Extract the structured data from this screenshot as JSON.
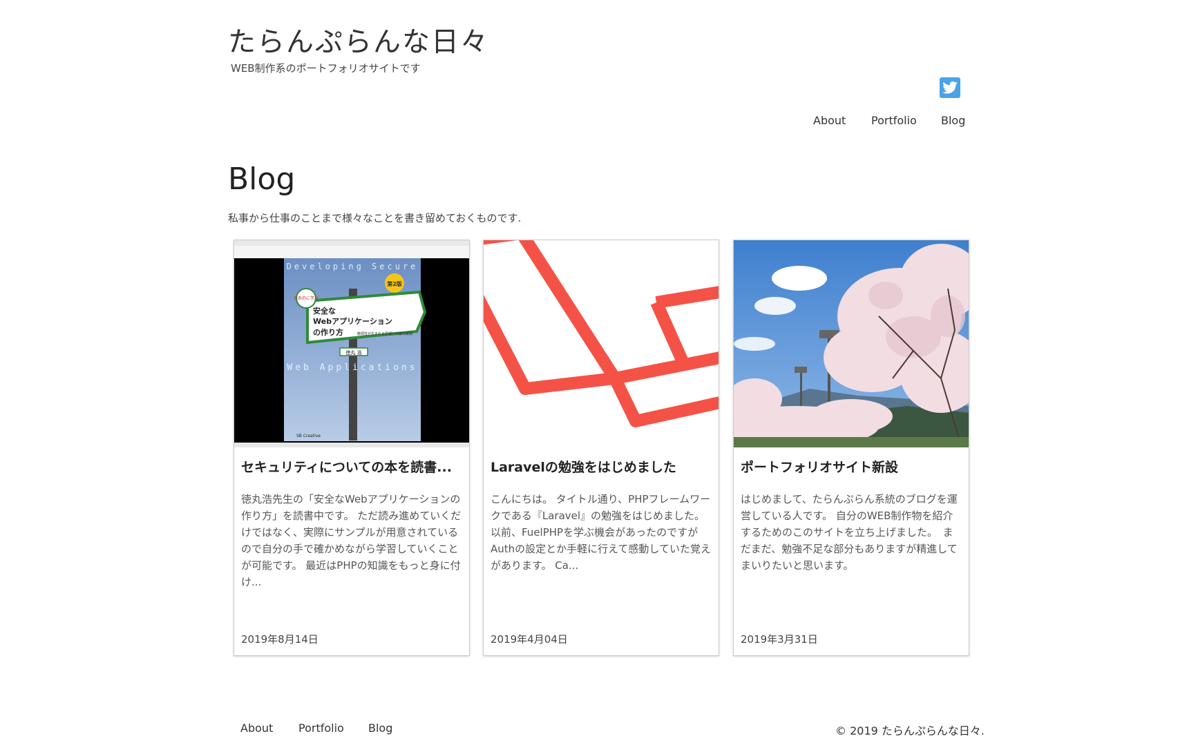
{
  "header": {
    "site_title": "たらんぷらんな日々",
    "site_description": "WEB制作系のポートフォリオサイトです"
  },
  "nav": {
    "items": [
      {
        "label": "About"
      },
      {
        "label": "Portfolio"
      },
      {
        "label": "Blog"
      }
    ]
  },
  "main": {
    "title": "Blog",
    "lead": "私事から仕事のことまで様々なことを書き留めておくものです."
  },
  "cards": [
    {
      "title": "セキュリティについての本を読書...",
      "excerpt": "徳丸浩先生の「安全なWebアプリケーションの作り方」を読書中です。 ただ読み進めていくだけではなく、実際にサンプルが用意されているので自分の手で確かめながら学習していくことが可能です。 最近はPHPの知識をもっと身に付け...",
      "date": "2019年8月14日",
      "thumb": {
        "top_text": "Developing Secure",
        "badge": "第2版",
        "sign_small": "体系的に学ぶ",
        "sign_line1": "安全な",
        "sign_line2": "Webアプリケーション",
        "sign_line3": "の作り方",
        "sign_sub": "脆弱性が生まれる原理と対策の実践",
        "author": "徳丸 浩",
        "bottom_text": "Web Applications",
        "publisher": "SB Creative"
      }
    },
    {
      "title": "Laravelの勉強をはじめました",
      "excerpt": "こんにちは。 タイトル通り、PHPフレームワークである『Laravel』の勉強をはじめました。　以前、FuelPHPを学ぶ機会があったのですがAuthの設定とか手軽に行えて感動していた覚えがあります。 Ca...",
      "date": "2019年4月04日"
    },
    {
      "title": "ポートフォリオサイト新設",
      "excerpt": "はじめまして、たらんぷらん系統のブログを運営している人です。 自分のWEB制作物を紹介するためのこのサイトを立ち上げました。　まだまだ、勉強不足な部分もありますが精進してまいりたいと思います。",
      "date": "2019年3月31日"
    }
  ],
  "footer": {
    "nav": [
      {
        "label": "About"
      },
      {
        "label": "Portfolio"
      },
      {
        "label": "Blog"
      }
    ],
    "copyright": "© 2019 たらんぷらんな日々."
  },
  "colors": {
    "twitter": "#4aa3e6",
    "laravel": "#f55247",
    "sign_green": "#2f8a3a",
    "sky": "#4a8fd4"
  },
  "icons": {
    "twitter": "twitter-icon"
  }
}
